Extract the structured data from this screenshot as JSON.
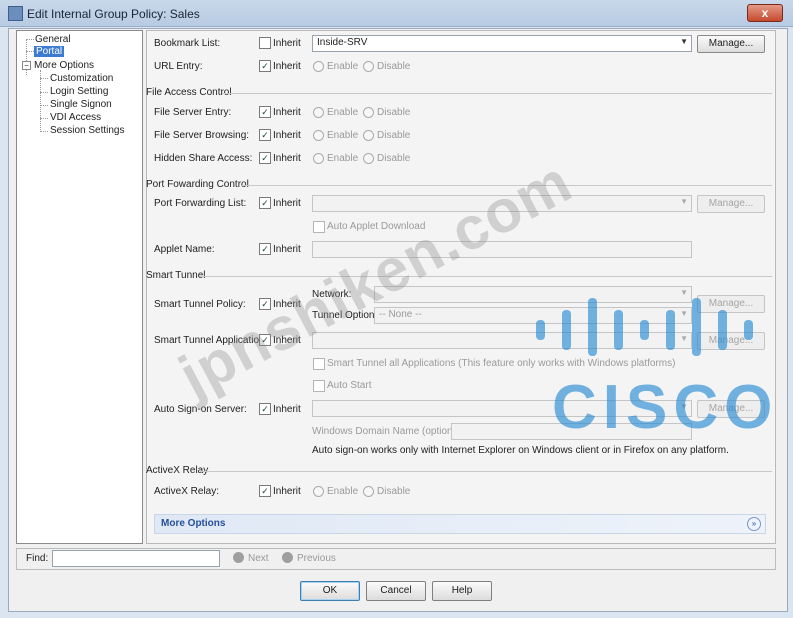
{
  "window": {
    "title": "Edit Internal Group Policy: Sales",
    "close_label": "x"
  },
  "tree": {
    "general": "General",
    "portal": "Portal",
    "more_options": "More Options",
    "children": [
      "Customization",
      "Login Setting",
      "Single Signon",
      "VDI Access",
      "Session Settings"
    ]
  },
  "inherit_label": "Inherit",
  "enable_label": "Enable",
  "disable_label": "Disable",
  "manage_label": "Manage...",
  "bookmark": {
    "label": "Bookmark List:",
    "value": "Inside-SRV"
  },
  "url_entry": {
    "label": "URL Entry:"
  },
  "sections": {
    "file_access": "File Access Control",
    "port_forwarding": "Port Fowarding Control",
    "smart_tunnel": "Smart Tunnel",
    "activex": "ActiveX Relay"
  },
  "file_server_entry": "File Server Entry:",
  "file_server_browsing": "File Server Browsing:",
  "hidden_share_access": "Hidden Share Access:",
  "port_forwarding_list": "Port Forwarding List:",
  "auto_applet_download": "Auto Applet Download",
  "applet_name": "Applet Name:",
  "smart_tunnel_policy": "Smart Tunnel Policy:",
  "network_label": "Network:",
  "tunnel_option_label": "Tunnel Option:",
  "tunnel_option_value": "-- None --",
  "smart_tunnel_application": "Smart Tunnel Application:",
  "smart_tunnel_all_apps": "Smart Tunnel all Applications (This feature only works with Windows platforms)",
  "auto_start": "Auto Start",
  "auto_signon_server": "Auto Sign-on Server:",
  "windows_domain_name": "Windows Domain Name (optional):",
  "auto_signon_note": "Auto sign-on works only with Internet Explorer on Windows client or in Firefox on any platform.",
  "activex_relay": "ActiveX Relay:",
  "more_options_bar": "More Options",
  "find": {
    "label": "Find:",
    "next": "Next",
    "previous": "Previous"
  },
  "buttons": {
    "ok": "OK",
    "cancel": "Cancel",
    "help": "Help"
  },
  "watermark": "jpnshiken.com",
  "logo_text": "CISCO"
}
